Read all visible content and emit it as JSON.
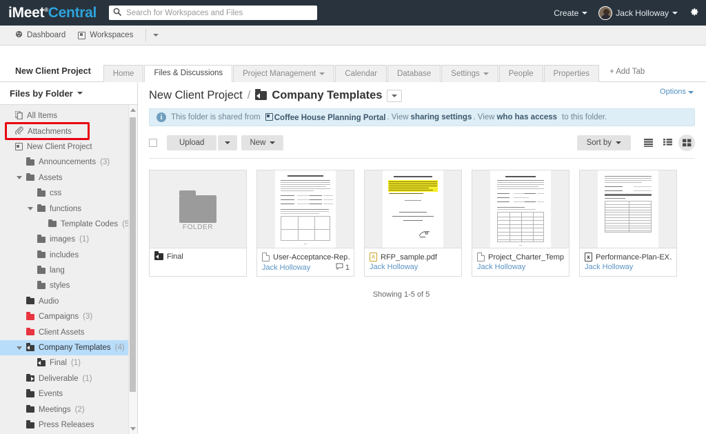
{
  "brand": {
    "name_white": "iMeet",
    "name_blue": "Central",
    "tm": "®"
  },
  "search": {
    "placeholder": "Search for Workspaces and Files",
    "value": "",
    "icon": "search-icon"
  },
  "topbar": {
    "create_label": "Create",
    "user_name": "Jack Holloway",
    "gear_icon": "gear-icon"
  },
  "navbar": {
    "dashboard": "Dashboard",
    "workspaces": "Workspaces"
  },
  "workspace": {
    "name": "New Client Project"
  },
  "tabs": [
    {
      "label": "Home",
      "active": false,
      "caret": false
    },
    {
      "label": "Files & Discussions",
      "active": true,
      "caret": false
    },
    {
      "label": "Project Management",
      "active": false,
      "caret": true
    },
    {
      "label": "Calendar",
      "active": false,
      "caret": false
    },
    {
      "label": "Database",
      "active": false,
      "caret": false
    },
    {
      "label": "Settings",
      "active": false,
      "caret": true
    },
    {
      "label": "People",
      "active": false,
      "caret": false
    },
    {
      "label": "Properties",
      "active": false,
      "caret": false
    }
  ],
  "add_tab_label": "+ Add Tab",
  "sidebar": {
    "header": "Files by Folder",
    "items": [
      {
        "label": "All Items",
        "count": "",
        "indent": 0,
        "icon": "copy-icon",
        "twisty": "",
        "selected": false,
        "color": "gray"
      },
      {
        "label": "Attachments",
        "count": "",
        "indent": 0,
        "icon": "paperclip-icon",
        "twisty": "",
        "selected": false,
        "color": "gray"
      },
      {
        "label": "New Client Project",
        "count": "",
        "indent": 0,
        "icon": "workspace-icon",
        "twisty": "",
        "selected": false,
        "color": "gray"
      },
      {
        "label": "Announcements",
        "count": "(3)",
        "indent": 1,
        "icon": "folder-icon",
        "twisty": "",
        "selected": false,
        "color": "gray"
      },
      {
        "label": "Assets",
        "count": "",
        "indent": 1,
        "icon": "folder-icon",
        "twisty": "down",
        "selected": false,
        "color": "gray"
      },
      {
        "label": "css",
        "count": "",
        "indent": 2,
        "icon": "folder-icon",
        "twisty": "",
        "selected": false,
        "color": "gray"
      },
      {
        "label": "functions",
        "count": "",
        "indent": 2,
        "icon": "folder-icon",
        "twisty": "down",
        "selected": false,
        "color": "gray"
      },
      {
        "label": "Template Codes",
        "count": "(5",
        "indent": 3,
        "icon": "folder-icon",
        "twisty": "",
        "selected": false,
        "color": "gray"
      },
      {
        "label": "images",
        "count": "(1)",
        "indent": 2,
        "icon": "folder-icon",
        "twisty": "",
        "selected": false,
        "color": "gray"
      },
      {
        "label": "includes",
        "count": "",
        "indent": 2,
        "icon": "folder-icon",
        "twisty": "",
        "selected": false,
        "color": "gray"
      },
      {
        "label": "lang",
        "count": "",
        "indent": 2,
        "icon": "folder-icon",
        "twisty": "",
        "selected": false,
        "color": "gray"
      },
      {
        "label": "styles",
        "count": "",
        "indent": 2,
        "icon": "folder-icon",
        "twisty": "",
        "selected": false,
        "color": "gray"
      },
      {
        "label": "Audio",
        "count": "",
        "indent": 1,
        "icon": "folder-icon",
        "twisty": "",
        "selected": false,
        "color": "dark"
      },
      {
        "label": "Campaigns",
        "count": "(3)",
        "indent": 1,
        "icon": "folder-icon",
        "twisty": "",
        "selected": false,
        "color": "red"
      },
      {
        "label": "Client Assets",
        "count": "",
        "indent": 1,
        "icon": "folder-icon",
        "twisty": "",
        "selected": false,
        "color": "red"
      },
      {
        "label": "Company Templates",
        "count": "(4)",
        "indent": 1,
        "icon": "folder-shared-icon",
        "twisty": "down",
        "selected": true,
        "color": "dark"
      },
      {
        "label": "Final",
        "count": "(1)",
        "indent": 2,
        "icon": "folder-shared-icon",
        "twisty": "",
        "selected": false,
        "color": "dark"
      },
      {
        "label": "Deliverable",
        "count": "(1)",
        "indent": 1,
        "icon": "folder-link-icon",
        "twisty": "",
        "selected": false,
        "color": "dark"
      },
      {
        "label": "Events",
        "count": "",
        "indent": 1,
        "icon": "folder-icon",
        "twisty": "",
        "selected": false,
        "color": "dark"
      },
      {
        "label": "Meetings",
        "count": "(2)",
        "indent": 1,
        "icon": "folder-icon",
        "twisty": "",
        "selected": false,
        "color": "dark"
      },
      {
        "label": "Press Releases",
        "count": "",
        "indent": 1,
        "icon": "folder-icon",
        "twisty": "",
        "selected": false,
        "color": "dark"
      }
    ],
    "highlight_item": "Attachments"
  },
  "content": {
    "options_label": "Options",
    "breadcrumb_parent": "New Client Project",
    "breadcrumb_sep": "/",
    "breadcrumb_current": "Company Templates",
    "notice": {
      "text_1": "This folder is shared from",
      "source": "Coffee House Planning Portal",
      "text_2": ". View",
      "link_1": "sharing settings",
      "text_3": ". View",
      "link_2": "who has access",
      "text_4": "to this folder."
    },
    "toolbar": {
      "upload_label": "Upload",
      "new_label": "New",
      "sort_label": "Sort by",
      "view_list": "list-view-icon",
      "view_detail": "detail-view-icon",
      "view_grid": "grid-view-icon",
      "active_view": "grid"
    },
    "files": [
      {
        "type": "folder",
        "name": "Final",
        "owner": "",
        "comments": "",
        "icon": "folder-shared-icon",
        "thumb_label": "FOLDER"
      },
      {
        "type": "doc",
        "name": "User-Acceptance-Rep…",
        "owner": "Jack Holloway",
        "comments": "1",
        "icon": "document-icon",
        "thumb_label": ""
      },
      {
        "type": "pdf",
        "name": "RFP_sample.pdf",
        "owner": "Jack Holloway",
        "comments": "",
        "icon": "pdf-icon",
        "thumb_label": ""
      },
      {
        "type": "doc",
        "name": "Project_Charter_Temp…",
        "owner": "Jack Holloway",
        "comments": "",
        "icon": "document-icon",
        "thumb_label": ""
      },
      {
        "type": "xls",
        "name": "Performance-Plan-EX…",
        "owner": "Jack Holloway",
        "comments": "",
        "icon": "excel-icon",
        "thumb_label": ""
      }
    ],
    "showing": "Showing 1-5 of 5"
  },
  "colors": {
    "topbar": "#28333d",
    "brand_blue": "#2ea3dd",
    "selection_blue": "#b8ddfb",
    "notice_bg": "#deeef7",
    "link_blue": "#5a93c4",
    "highlight_red": "#e8000f",
    "folder_red": "#e8353f"
  }
}
